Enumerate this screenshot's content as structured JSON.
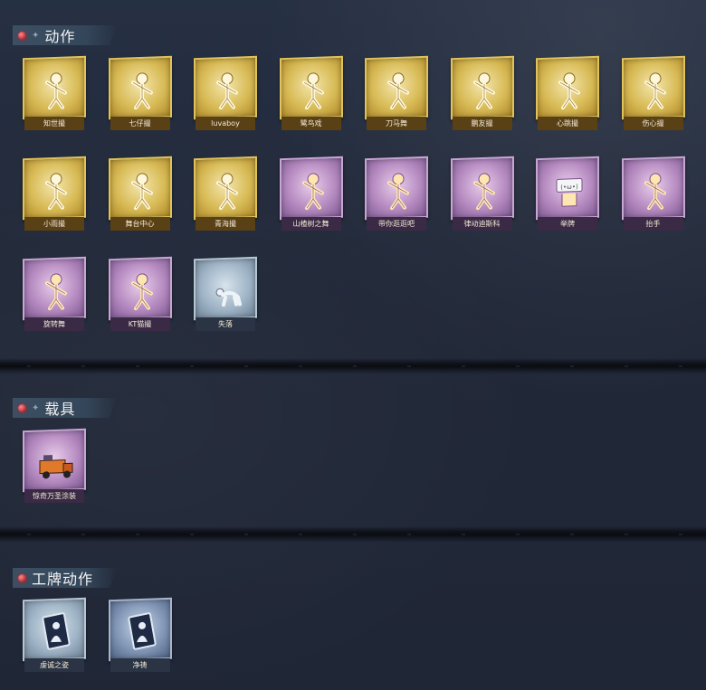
{
  "sections": [
    {
      "title": "动作",
      "items": [
        {
          "label": "知世撮",
          "rarity": "gold",
          "icon": "dance-pose-icon"
        },
        {
          "label": "七仔撮",
          "rarity": "gold",
          "icon": "dance-pose-icon"
        },
        {
          "label": "luvaboy",
          "rarity": "gold",
          "icon": "dance-pose-icon"
        },
        {
          "label": "鹭鸟戏",
          "rarity": "gold",
          "icon": "dance-pose-icon"
        },
        {
          "label": "刀马舞",
          "rarity": "gold",
          "icon": "dance-pose-icon"
        },
        {
          "label": "鹏友撮",
          "rarity": "gold",
          "icon": "dance-pose-icon"
        },
        {
          "label": "心跳撮",
          "rarity": "gold",
          "icon": "heart-pose-icon"
        },
        {
          "label": "伤心撮",
          "rarity": "gold",
          "icon": "sad-pose-icon"
        },
        {
          "label": "小雨撮",
          "rarity": "gold",
          "icon": "dance-pose-icon"
        },
        {
          "label": "舞台中心",
          "rarity": "gold",
          "icon": "dance-pose-icon"
        },
        {
          "label": "青海撮",
          "rarity": "gold",
          "icon": "dance-pose-icon"
        },
        {
          "label": "山楂树之舞",
          "rarity": "purple",
          "icon": "dance-pose-icon"
        },
        {
          "label": "带你逛逛吧",
          "rarity": "purple",
          "icon": "point-pose-icon"
        },
        {
          "label": "律动迪斯科",
          "rarity": "purple",
          "icon": "disco-pose-icon"
        },
        {
          "label": "举牌",
          "rarity": "purple",
          "icon": "sign-holding-icon"
        },
        {
          "label": "抬手",
          "rarity": "purple",
          "icon": "raise-hand-icon"
        },
        {
          "label": "旋转舞",
          "rarity": "purple",
          "icon": "spin-pose-icon"
        },
        {
          "label": "KT猫撮",
          "rarity": "purple",
          "icon": "dance-pose-icon"
        },
        {
          "label": "失落",
          "rarity": "silver",
          "icon": "crawl-pose-icon"
        }
      ]
    },
    {
      "title": "载具",
      "items": [
        {
          "label": "惊奇万圣涂装",
          "rarity": "purple",
          "icon": "truck-icon"
        }
      ]
    },
    {
      "title": "工牌动作",
      "items": [
        {
          "label": "虔诚之姿",
          "rarity": "silver",
          "icon": "badge-card-icon"
        },
        {
          "label": "净祷",
          "rarity": "blue",
          "icon": "badge-card-icon"
        }
      ]
    }
  ],
  "colors": {
    "background": "#232a3a",
    "gold": "#d8bb56",
    "purple": "#b58ac0",
    "silver": "#9fb4c6",
    "blue": "#8297b6",
    "accent_gem": "#b3262e"
  }
}
